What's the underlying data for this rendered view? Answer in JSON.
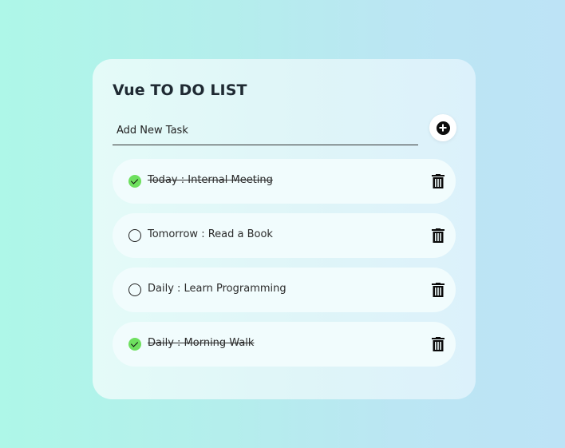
{
  "app": {
    "title": "Vue TO DO LIST"
  },
  "add_task": {
    "placeholder": "Add New Task",
    "value": "",
    "button_icon": "plus-circle-icon"
  },
  "tasks": [
    {
      "label": "Today : Internal Meeting",
      "done": true
    },
    {
      "label": "Tomorrow : Read a Book",
      "done": false
    },
    {
      "label": "Daily : Learn Programming",
      "done": false
    },
    {
      "label": "Daily : Morning Walk",
      "done": true
    }
  ],
  "icons": {
    "done": "check-circle-icon",
    "open": "empty-circle-icon",
    "delete": "trash-icon"
  },
  "colors": {
    "done_check": "#6ee05f",
    "card_bg": "#e4fbf8",
    "task_bg": "#f1fcfd"
  }
}
